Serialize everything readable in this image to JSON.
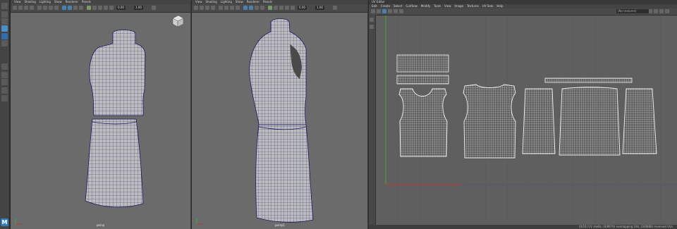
{
  "viewport_left": {
    "menu": [
      "View",
      "Shading",
      "Lighting",
      "Show",
      "Renderer",
      "Panels"
    ],
    "fields": {
      "value_a": "0.00",
      "value_b": "1.00"
    },
    "camera_label": "persp"
  },
  "viewport_right": {
    "menu": [
      "View",
      "Shading",
      "Lighting",
      "Show",
      "Renderer",
      "Panels"
    ],
    "fields": {
      "value_a": "0.00",
      "value_b": "1.00"
    },
    "camera_label": "persp1"
  },
  "uv_editor": {
    "title": "UV Editor",
    "menu": [
      "Edit",
      "Create",
      "Select",
      "Cut/Sew",
      "Modify",
      "Tools",
      "View",
      "Image",
      "Textures",
      "UV Sets",
      "Help"
    ],
    "texture_field": "(No textures)",
    "status": "(0/16) UV shells, (0/8976) overlapping UVs, (0/8880) reversed UVs"
  },
  "colors": {
    "viewport_bg": "#6b6b6b",
    "uv_bg": "#5f5f5f",
    "wire": "#1f1f4a",
    "uv_shell": "#f2f2f2",
    "axis_x": "#c83232",
    "axis_y": "#32b432"
  },
  "logo_text": "M"
}
